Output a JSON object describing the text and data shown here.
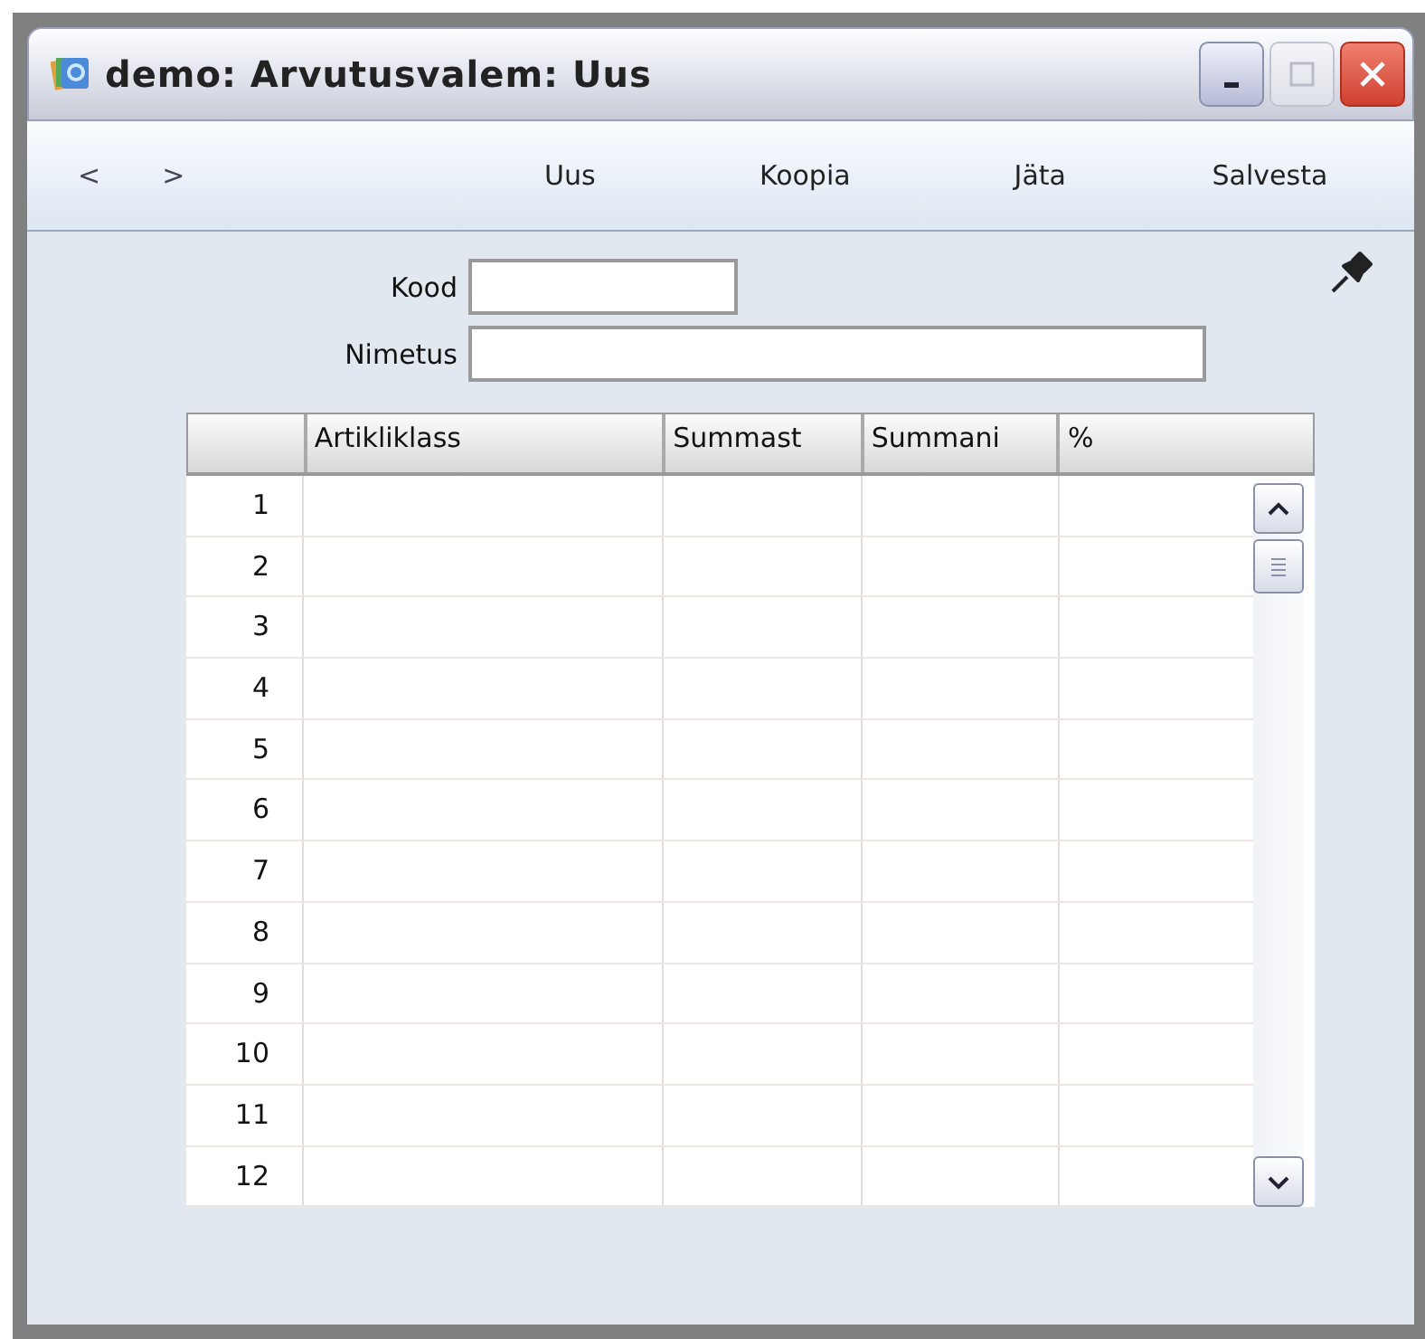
{
  "window": {
    "title": "demo: Arvutusvalem: Uus"
  },
  "toolbar": {
    "nav": [
      "<",
      ">"
    ],
    "buttons": [
      "Uus",
      "Koopia",
      "Jäta",
      "Salvesta"
    ]
  },
  "form": {
    "fields": [
      {
        "label": "Kood",
        "kind": "short"
      },
      {
        "label": "Nimetus",
        "kind": "long"
      }
    ]
  },
  "table": {
    "columns": [
      "Artikliklass",
      "Summast",
      "Summani",
      "%"
    ],
    "rows": [
      "1",
      "2",
      "3",
      "4",
      "5",
      "6",
      "7",
      "8",
      "9",
      "10",
      "11",
      "12"
    ]
  }
}
